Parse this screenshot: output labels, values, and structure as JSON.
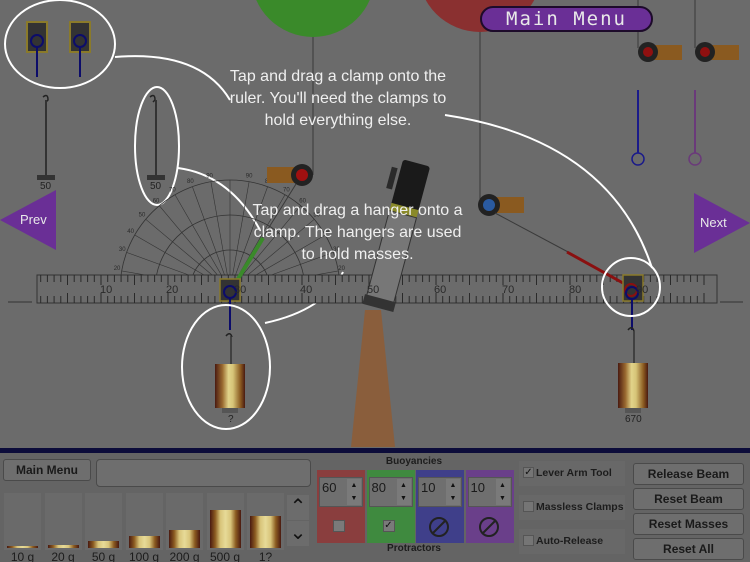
{
  "top_menu": {
    "main_menu_label": "Main Menu"
  },
  "nav": {
    "prev_label": "Prev",
    "next_label": "Next"
  },
  "tips": {
    "clamp_tip": "Tap and drag a clamp onto the ruler. You'll need the clamps to hold everything else.",
    "hanger_tip": "Tap and drag a hanger onto a clamp. The hangers are used to hold masses."
  },
  "hangers": [
    {
      "label": "50"
    },
    {
      "label": "50"
    }
  ],
  "ruler": {
    "tick_labels": [
      "10",
      "20",
      "30",
      "40",
      "50",
      "60",
      "70",
      "80",
      "90"
    ]
  },
  "protractor": {
    "tick_labels": [
      "10",
      "20",
      "30",
      "40",
      "50",
      "60",
      "70",
      "80",
      "90"
    ]
  },
  "hung_masses": [
    {
      "label": "?"
    },
    {
      "label": "670"
    }
  ],
  "colors": {
    "accent_purple": "#6a2f96",
    "buoy_red": "#8a3e3e",
    "buoy_green": "#3f8a3f",
    "buoy_blue": "#3f3f8a",
    "buoy_purple": "#6a3f8a",
    "panel_border": "#0c0c3a"
  },
  "panel": {
    "main_menu_label": "Main Menu",
    "status_text": "",
    "masses": [
      {
        "label": "10 g",
        "fill": 0.03
      },
      {
        "label": "20 g",
        "fill": 0.05
      },
      {
        "label": "50 g",
        "fill": 0.12
      },
      {
        "label": "100 g",
        "fill": 0.22
      },
      {
        "label": "200 g",
        "fill": 0.32
      },
      {
        "label": "500 g",
        "fill": 0.7
      },
      {
        "label": "1?",
        "fill": 0.58
      }
    ],
    "scroll_up_icon": "^",
    "scroll_down_icon": "v",
    "buoyancies_title": "Buoyancies",
    "protractors_title": "Protractors",
    "buoyancies": [
      {
        "color": "red",
        "value": "60",
        "protractor": "unchecked"
      },
      {
        "color": "green",
        "value": "80",
        "protractor": "checked"
      },
      {
        "color": "blue",
        "value": "10",
        "protractor": "disabled"
      },
      {
        "color": "purple",
        "value": "10",
        "protractor": "disabled"
      }
    ],
    "options": [
      {
        "label": "Lever Arm Tool",
        "checked": true
      },
      {
        "label": "Massless Clamps",
        "checked": false
      },
      {
        "label": "Auto-Release",
        "checked": false
      }
    ],
    "buttons": {
      "release_beam": "Release Beam",
      "reset_beam": "Reset Beam",
      "reset_masses": "Reset Masses",
      "reset_all": "Reset All"
    }
  }
}
